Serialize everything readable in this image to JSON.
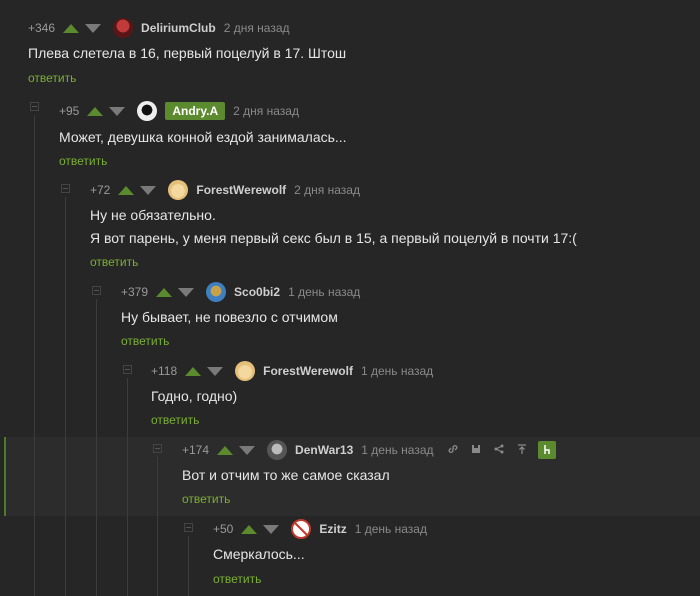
{
  "comments": [
    {
      "rating": "+346",
      "user": "DeliriumClub",
      "time": "2 дня назад",
      "lines": [
        "Плева слетела в 16, первый поцелуй в 17. Штош"
      ],
      "reply": "ответить"
    },
    {
      "rating": "+95",
      "user": "Andry.A",
      "time": "2 дня назад",
      "lines": [
        "Может, девушка конной ездой занималась..."
      ],
      "reply": "ответить"
    },
    {
      "rating": "+72",
      "user": "ForestWerewolf",
      "time": "2 дня назад",
      "lines": [
        "Ну не обязательно.",
        "Я вот парень, у меня первый секс был в 15, а первый поцелуй в почти 17:("
      ],
      "reply": "ответить"
    },
    {
      "rating": "+379",
      "user": "Sco0bi2",
      "time": "1 день назад",
      "lines": [
        "Ну бывает, не повезло с отчимом"
      ],
      "reply": "ответить"
    },
    {
      "rating": "+118",
      "user": "ForestWerewolf",
      "time": "1 день назад",
      "lines": [
        "Годно, годно)"
      ],
      "reply": "ответить"
    },
    {
      "rating": "+174",
      "user": "DenWar13",
      "time": "1 день назад",
      "lines": [
        "Вот и отчим то же самое сказал"
      ],
      "reply": "ответить"
    },
    {
      "rating": "+50",
      "user": "Ezitz",
      "time": "1 день назад",
      "lines": [
        "Смеркалось..."
      ],
      "reply": "ответить"
    }
  ],
  "colors": {
    "accent": "#5c8a2e",
    "link": "#7ab032",
    "background": "#262626",
    "highlight": "#2c2c2c"
  },
  "icons": {
    "upvote": "triangle-up-icon",
    "downvote": "triangle-down-icon",
    "actions": [
      "link-icon",
      "save-icon",
      "share-icon",
      "pin-top-icon",
      "tree-icon"
    ]
  }
}
